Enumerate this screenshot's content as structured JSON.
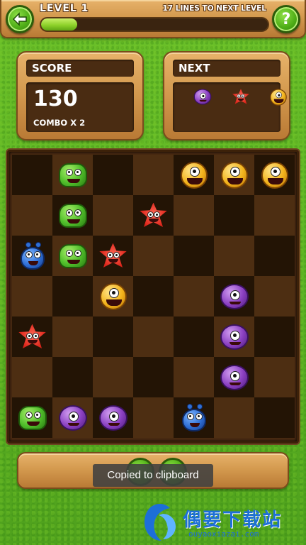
{
  "header": {
    "level_label": "LEVEL 1",
    "lines_to_next": "17 LINES TO NEXT LEVEL",
    "progress_fraction": 0.16,
    "back_icon": "arrow-left-icon",
    "help_label": "?"
  },
  "score_panel": {
    "title": "SCORE",
    "value": "130",
    "combo": "COMBO X 2"
  },
  "next_panel": {
    "title": "NEXT",
    "items": [
      "purple",
      "red",
      "orange"
    ]
  },
  "board": {
    "rows": 7,
    "cols": 7,
    "cells": [
      [
        "",
        "green",
        "",
        "",
        "orange",
        "orange",
        "orange"
      ],
      [
        "",
        "green",
        "",
        "red",
        "",
        "",
        ""
      ],
      [
        "blue",
        "green",
        "red",
        "",
        "",
        "",
        ""
      ],
      [
        "",
        "",
        "orange",
        "",
        "",
        "purple",
        ""
      ],
      [
        "red",
        "",
        "",
        "",
        "",
        "purple",
        ""
      ],
      [
        "",
        "",
        "",
        "",
        "",
        "purple",
        ""
      ],
      [
        "green",
        "purple",
        "purple",
        "",
        "blue",
        "",
        ""
      ]
    ]
  },
  "toast": {
    "text": "Copied to clipboard"
  },
  "watermark": {
    "title": "偶要下载站",
    "url": "ouyaoxiazai.com"
  },
  "colors": {
    "grass": "#5cb324",
    "wood": "#d49a4f",
    "panel_dark": "#4a2c12",
    "button_green": "#4fae17"
  }
}
